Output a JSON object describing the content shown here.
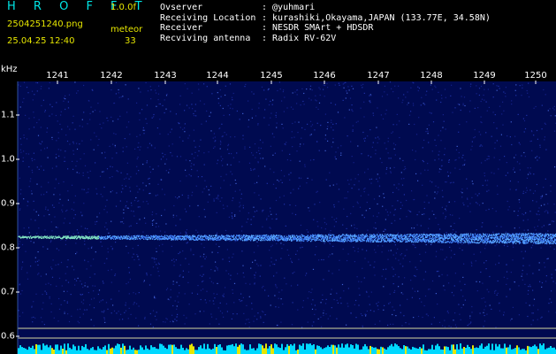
{
  "header": {
    "app_title": "H R O F F T",
    "version": "1.0.0f",
    "filename": "2504251240.png",
    "datetime": "25.04.25 12:40",
    "mode": "meteor",
    "count": "33",
    "info": [
      {
        "label": "Ovserver",
        "value": ": @yuhmari"
      },
      {
        "label": "Receiving Location",
        "value": ": kurashiki,Okayama,JAPAN (133.77E, 34.58N)"
      },
      {
        "label": "Receiver",
        "value": ": NESDR SMArt + HDSDR"
      },
      {
        "label": "Recviving antenna",
        "value": ": Radix RV-62V"
      }
    ]
  },
  "axis": {
    "unit": "kHz",
    "top_ticks": [
      "1241",
      "1242",
      "1243",
      "1244",
      "1245",
      "1246",
      "1247",
      "1248",
      "1249",
      "1250"
    ],
    "left_ticks": [
      "1.1",
      "1.0",
      "0.9",
      "0.8",
      "0.7",
      "0.6"
    ]
  },
  "colors": {
    "background": "#000000",
    "plot_bg": "#000a50",
    "title": "#00e6e6",
    "meta_yellow": "#e6e600",
    "trace": "#4aa0ff",
    "trace_bright": "#7fe0c0",
    "guide_line": "#e6e6a0",
    "bottom_bar": "#00d8ff"
  }
}
